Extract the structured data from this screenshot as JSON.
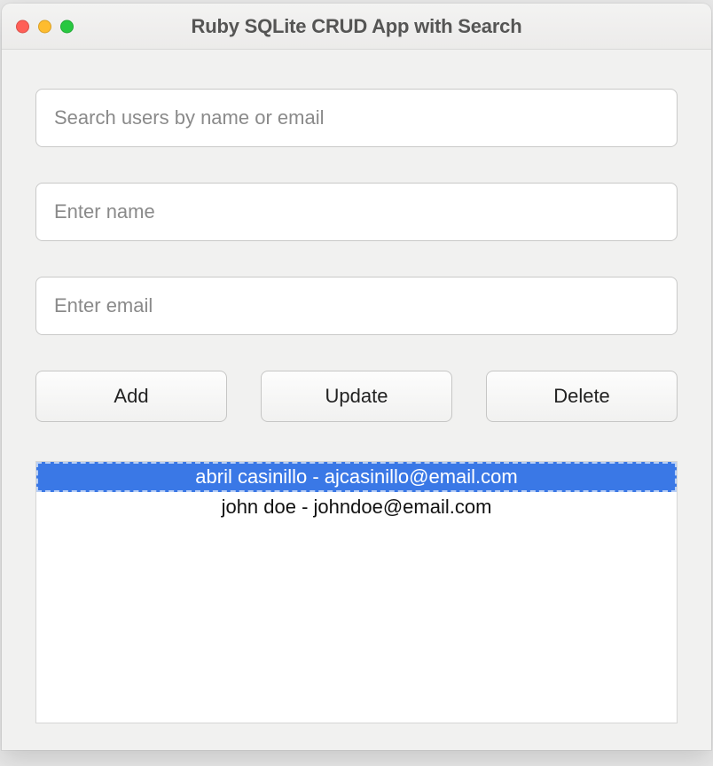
{
  "window": {
    "title": "Ruby SQLite CRUD App with Search"
  },
  "fields": {
    "search": {
      "value": "",
      "placeholder": "Search users by name or email"
    },
    "name": {
      "value": "",
      "placeholder": "Enter name"
    },
    "email": {
      "value": "",
      "placeholder": "Enter email"
    }
  },
  "buttons": {
    "add": "Add",
    "update": "Update",
    "delete": "Delete"
  },
  "list": {
    "selected_index": 0,
    "items": [
      {
        "label": "abril casinillo - ajcasinillo@email.com"
      },
      {
        "label": "john doe - johndoe@email.com"
      }
    ]
  },
  "colors": {
    "selection": "#3a78e6"
  }
}
